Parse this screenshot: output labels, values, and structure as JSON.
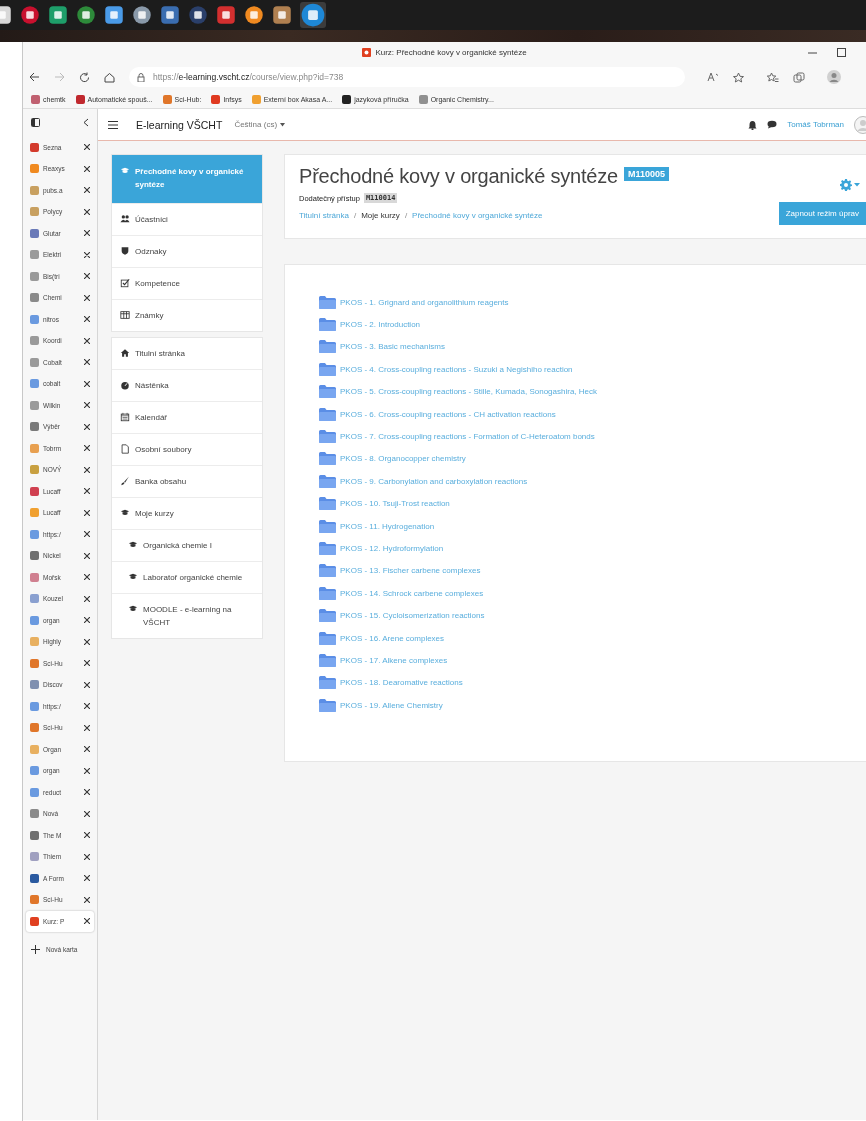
{
  "taskbar": {
    "apps": [
      {
        "color": "#d8d8d8",
        "selected": false
      },
      {
        "color": "#c8102e",
        "selected": false
      },
      {
        "color": "#1e9e6a",
        "selected": false
      },
      {
        "color": "#2d8a3a",
        "selected": false
      },
      {
        "color": "#4a9be8",
        "selected": false
      },
      {
        "color": "#8a9aaa",
        "selected": false
      },
      {
        "color": "#3a6db0",
        "selected": false
      },
      {
        "color": "#2a3f6a",
        "selected": false
      },
      {
        "color": "#d32f2f",
        "selected": false
      },
      {
        "color": "#f08a20",
        "selected": false
      },
      {
        "color": "#b08050",
        "selected": false
      },
      {
        "color": "#1e88d6",
        "selected": true
      }
    ]
  },
  "window": {
    "title": "Kurz: Přechodné kovy v organické syntéze"
  },
  "address_bar": {
    "url_scheme": "https://",
    "url_host": "e-learning.vscht.cz",
    "url_path": "/course/view.php?id=738"
  },
  "bookmarks": [
    {
      "label": "chemtk",
      "color": "#c06070"
    },
    {
      "label": "Automatické spouš...",
      "color": "#c0282e"
    },
    {
      "label": "Sci-Hub:",
      "color": "#e0762a"
    },
    {
      "label": "Infsys",
      "color": "#e03a20"
    },
    {
      "label": "Externí box Akasa A...",
      "color": "#f0a030"
    },
    {
      "label": "jazyková příručka",
      "color": "#222222"
    },
    {
      "label": "Organic Chemistry...",
      "color": "#909090"
    }
  ],
  "tabs": [
    {
      "label": "Sezna",
      "color": "#d33a2c",
      "selected": false
    },
    {
      "label": "Reaxys",
      "color": "#f08a20",
      "selected": false
    },
    {
      "label": "pubs.a",
      "color": "#c8a060",
      "selected": false
    },
    {
      "label": "Polycy",
      "color": "#c8a060",
      "selected": false
    },
    {
      "label": "Glutar",
      "color": "#6a7ab8",
      "selected": false
    },
    {
      "label": "Elektri",
      "color": "#9a9a9a",
      "selected": false
    },
    {
      "label": "Bis(tri",
      "color": "#9a9a9a",
      "selected": false
    },
    {
      "label": "Chemi",
      "color": "#8a8a8a",
      "selected": false
    },
    {
      "label": "nitros",
      "color": "#6a9ae0",
      "selected": false
    },
    {
      "label": "Koordi",
      "color": "#9a9a9a",
      "selected": false
    },
    {
      "label": "Cobalt",
      "color": "#9a9a9a",
      "selected": false
    },
    {
      "label": "cobalt",
      "color": "#6a9ae0",
      "selected": false
    },
    {
      "label": "Wilkin",
      "color": "#9a9a9a",
      "selected": false
    },
    {
      "label": "Výběr",
      "color": "#7a7a7a",
      "selected": false
    },
    {
      "label": "Tobrm",
      "color": "#e8a050",
      "selected": false
    },
    {
      "label": "NOVÝ",
      "color": "#c8a040",
      "selected": false
    },
    {
      "label": "Lucaff",
      "color": "#d04050",
      "selected": false
    },
    {
      "label": "Lucaff",
      "color": "#f0a030",
      "selected": false
    },
    {
      "label": "https:/",
      "color": "#6a9ae0",
      "selected": false
    },
    {
      "label": "Nickel",
      "color": "#707070",
      "selected": false
    },
    {
      "label": "Mořsk",
      "color": "#d08090",
      "selected": false
    },
    {
      "label": "Kouzel",
      "color": "#8aa0d0",
      "selected": false
    },
    {
      "label": "organ",
      "color": "#6a9ae0",
      "selected": false
    },
    {
      "label": "Highly",
      "color": "#e8b060",
      "selected": false
    },
    {
      "label": "Sci-Hu",
      "color": "#e0762a",
      "selected": false
    },
    {
      "label": "Discov",
      "color": "#8090b0",
      "selected": false
    },
    {
      "label": "https:/",
      "color": "#6a9ae0",
      "selected": false
    },
    {
      "label": "Sci-Hu",
      "color": "#e0762a",
      "selected": false
    },
    {
      "label": "Organ",
      "color": "#e8b060",
      "selected": false
    },
    {
      "label": "organ",
      "color": "#6a9ae0",
      "selected": false
    },
    {
      "label": "reduct",
      "color": "#6a9ae0",
      "selected": false
    },
    {
      "label": "Nová",
      "color": "#8a8a8a",
      "selected": false
    },
    {
      "label": "The M",
      "color": "#707070",
      "selected": false
    },
    {
      "label": "Thiem",
      "color": "#a0a0c0",
      "selected": false
    },
    {
      "label": "A Form",
      "color": "#2a5aa0",
      "selected": false
    },
    {
      "label": "Sci-Hu",
      "color": "#e0762a",
      "selected": false
    },
    {
      "label": "Kurz: P",
      "color": "#e04020",
      "selected": true
    }
  ],
  "new_tab": {
    "label": "Nová karta"
  },
  "moodle_header": {
    "site_name": "E-learning VŠCHT",
    "language": "Čeština (cs)",
    "user_name": "Tomáš Tobrman"
  },
  "nav_drawer": {
    "groups": [
      {
        "items": [
          {
            "label": "Přechodné kovy v organické syntéze",
            "selected": true
          },
          {
            "label": "Účastníci",
            "selected": false
          },
          {
            "label": "Odznaky",
            "selected": false
          },
          {
            "label": "Kompetence",
            "selected": false
          },
          {
            "label": "Známky",
            "selected": false
          }
        ]
      },
      {
        "items": [
          {
            "label": "Titulní stránka",
            "selected": false
          },
          {
            "label": "Nástěnka",
            "selected": false
          },
          {
            "label": "Kalendář",
            "selected": false
          },
          {
            "label": "Osobní soubory",
            "selected": false
          },
          {
            "label": "Banka obsahu",
            "selected": false
          },
          {
            "label": "Moje kurzy",
            "selected": false,
            "children": [
              {
                "label": "Organická chemie I",
                "selected": false
              },
              {
                "label": "Laboratoř organické chemie",
                "selected": false
              },
              {
                "label": "MOODLE - e-learning na VŠCHT",
                "selected": false
              }
            ]
          }
        ]
      }
    ]
  },
  "course": {
    "title": "Přechodné kovy v organické syntéze",
    "code": "M110005",
    "extra_access_label": "Dodatečný přístup",
    "extra_access_code": "M110014",
    "breadcrumb": [
      {
        "label": "Titulní stránka",
        "kind": "link"
      },
      {
        "label": "/",
        "kind": "separator"
      },
      {
        "label": "Moje kurzy",
        "kind": "text"
      },
      {
        "label": "/",
        "kind": "separator"
      },
      {
        "label": "Přechodné kovy v organické syntéze",
        "kind": "link"
      }
    ],
    "edit_button": "Zapnout režim úprav"
  },
  "folders": [
    {
      "label": "PKOS - 1. Grignard and organolithium reagents"
    },
    {
      "label": "PKOS - 2. Introduction"
    },
    {
      "label": "PKOS - 3. Basic mechanisms"
    },
    {
      "label": "PKOS - 4. Cross-coupling reactions - Suzuki a Negishiho reaction"
    },
    {
      "label": "PKOS - 5. Cross-coupling reactions - Stille, Kumada, Sonogashira, Heck"
    },
    {
      "label": "PKOS - 6. Cross-coupling reactions - CH activation reactions"
    },
    {
      "label": "PKOS - 7. Cross-coupling reactions - Formation of C-Heteroatom bonds"
    },
    {
      "label": "PKOS - 8. Organocopper chemistry"
    },
    {
      "label": "PKOS - 9. Carbonylation and carboxylation reactions"
    },
    {
      "label": "PKOS - 10. Tsuji-Trost reaction"
    },
    {
      "label": "PKOS - 11. Hydrogenation"
    },
    {
      "label": "PKOS - 12. Hydroformylation"
    },
    {
      "label": "PKOS - 13. Fischer carbene complexes"
    },
    {
      "label": "PKOS - 14. Schrock carbene complexes"
    },
    {
      "label": "PKOS - 15. Cycloisomerization reactions"
    },
    {
      "label": "PKOS - 16. Arene complexes"
    },
    {
      "label": "PKOS - 17. Alkene complexes"
    },
    {
      "label": "PKOS - 18. Dearomative reactions"
    },
    {
      "label": "PKOS - 19. Allene Chemistry"
    }
  ]
}
